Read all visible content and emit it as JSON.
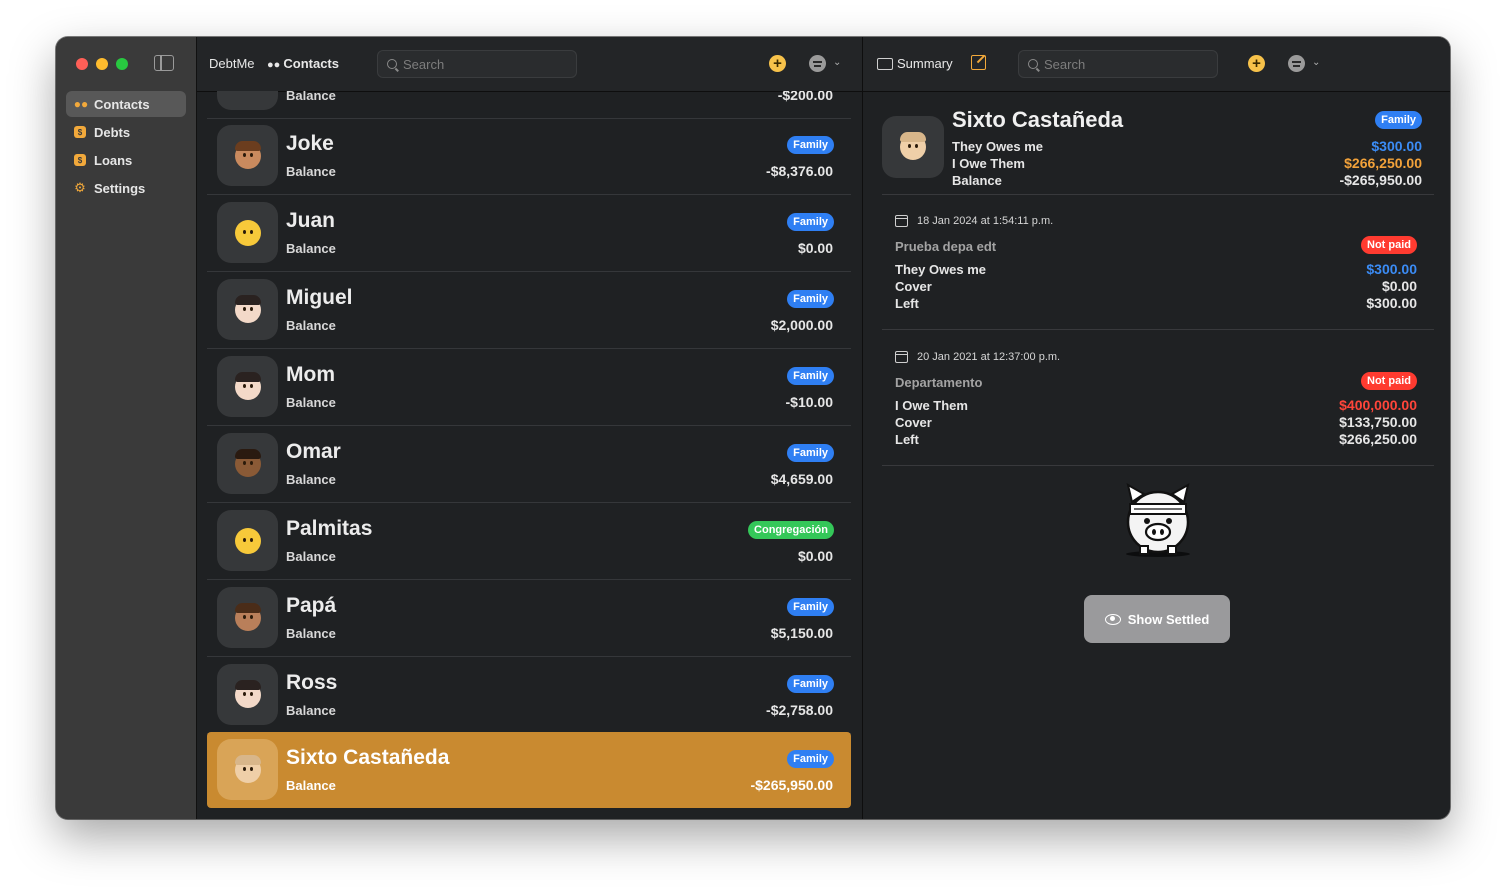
{
  "sidebar": {
    "items": [
      {
        "label": "Contacts",
        "icon": "people-icon"
      },
      {
        "label": "Debts",
        "icon": "dollar-icon"
      },
      {
        "label": "Loans",
        "icon": "dollar-icon"
      },
      {
        "label": "Settings",
        "icon": "gear-icon"
      }
    ]
  },
  "toolbar": {
    "app_name": "DebtMe",
    "section": "Contacts",
    "search_placeholder": "Search"
  },
  "contacts": [
    {
      "name": "",
      "sub": "Balance",
      "amount": "-$200.00",
      "tag": ""
    },
    {
      "name": "Joke",
      "sub": "Balance",
      "amount": "-$8,376.00",
      "tag": "Family"
    },
    {
      "name": "Juan",
      "sub": "Balance",
      "amount": "$0.00",
      "tag": "Family"
    },
    {
      "name": "Miguel",
      "sub": "Balance",
      "amount": "$2,000.00",
      "tag": "Family"
    },
    {
      "name": "Mom",
      "sub": "Balance",
      "amount": "-$10.00",
      "tag": "Family"
    },
    {
      "name": "Omar",
      "sub": "Balance",
      "amount": "$4,659.00",
      "tag": "Family"
    },
    {
      "name": "Palmitas",
      "sub": "Balance",
      "amount": "$0.00",
      "tag": "Congregación"
    },
    {
      "name": "Papá",
      "sub": "Balance",
      "amount": "$5,150.00",
      "tag": "Family"
    },
    {
      "name": "Ross",
      "sub": "Balance",
      "amount": "-$2,758.00",
      "tag": "Family"
    },
    {
      "name": "Sixto Castañeda",
      "sub": "Balance",
      "amount": "-$265,950.00",
      "tag": "Family"
    }
  ],
  "detail": {
    "toolbar_label": "Summary",
    "search_placeholder": "Search",
    "name": "Sixto Castañeda",
    "tag": "Family",
    "they_owe_label": "They Owes me",
    "they_owe_value": "$300.00",
    "i_owe_label": "I Owe Them",
    "i_owe_value": "$266,250.00",
    "balance_label": "Balance",
    "balance_value": "-$265,950.00",
    "debts": [
      {
        "date": "18 Jan 2024 at 1:54:11 p.m.",
        "title": "Prueba depa edt",
        "status": "Not paid",
        "type_label": "They Owes me",
        "type_value": "$300.00",
        "cover_label": "Cover",
        "cover_value": "$0.00",
        "left_label": "Left",
        "left_value": "$300.00"
      },
      {
        "date": "20 Jan 2021 at 12:37:00 p.m.",
        "title": "Departamento",
        "status": "Not paid",
        "type_label": "I Owe Them",
        "type_value": "$400,000.00",
        "cover_label": "Cover",
        "cover_value": "$133,750.00",
        "left_label": "Left",
        "left_value": "$266,250.00"
      }
    ],
    "show_settled_label": "Show Settled"
  },
  "colors": {
    "accent": "#c98a30",
    "blue_badge": "#2f7ff3",
    "green_badge": "#34c759",
    "red_badge": "#ff3b30",
    "blue_value": "#3b8cf5",
    "orange_value": "#f2a23a",
    "red_value": "#ff453a"
  }
}
